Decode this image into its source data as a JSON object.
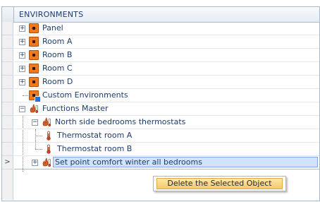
{
  "grid": {
    "header": "ENVIRONMENTS",
    "rows": [
      {
        "label": "Panel"
      },
      {
        "label": "Room A"
      },
      {
        "label": "Room B"
      },
      {
        "label": "Room C"
      },
      {
        "label": "Room D"
      },
      {
        "label": "Custom Environments"
      },
      {
        "label": "Functions Master"
      },
      {
        "label": "North side bedrooms thermostats"
      },
      {
        "label": "Thermostat room A"
      },
      {
        "label": "Thermostat room B"
      },
      {
        "label": "Set point comfort winter all bedrooms",
        "selected": true,
        "row_marker": ">"
      }
    ],
    "expand_symbol": "+",
    "collapse_symbol": "−"
  },
  "context_menu": {
    "items": [
      {
        "label": "Delete the Selected Object"
      }
    ]
  },
  "colors": {
    "room_icon": "#f27a1b",
    "selection": "#cfe3fb",
    "menu_highlight": "#f8c76a",
    "text": "#1e3c6e"
  },
  "icons": {
    "room": "orange-square-icon",
    "custom": "custom-environment-icon",
    "function": "flame-thermometer-icon",
    "thermostat": "thermometer-icon"
  }
}
